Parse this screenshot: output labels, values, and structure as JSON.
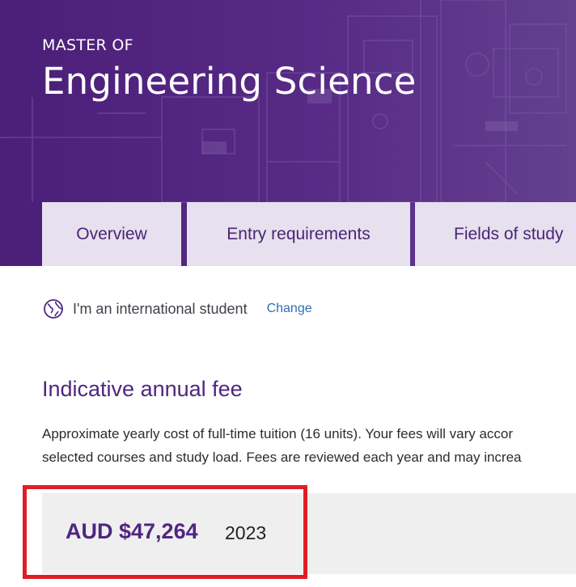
{
  "hero": {
    "kicker": "MASTER OF",
    "title": "Engineering Science",
    "background_color": "#52247f"
  },
  "tabs": [
    {
      "label": "Overview"
    },
    {
      "label": "Entry requirements"
    },
    {
      "label": "Fields of study"
    }
  ],
  "student_selector": {
    "icon": "globe-icon",
    "text": "I'm an international student",
    "change_label": "Change"
  },
  "fees": {
    "heading": "Indicative annual fee",
    "description_line1": "Approximate yearly cost of full-time tuition (16 units). Your fees will vary accor",
    "description_line2": "selected courses and study load. Fees are reviewed each year and may increa",
    "amount": "AUD $47,264",
    "year": "2023"
  },
  "colors": {
    "brand_purple": "#52247f",
    "heading_purple": "#4f2680",
    "tab_background": "#e7e0ee",
    "link_blue": "#2f6fb5",
    "highlight_red": "#e01e26"
  }
}
